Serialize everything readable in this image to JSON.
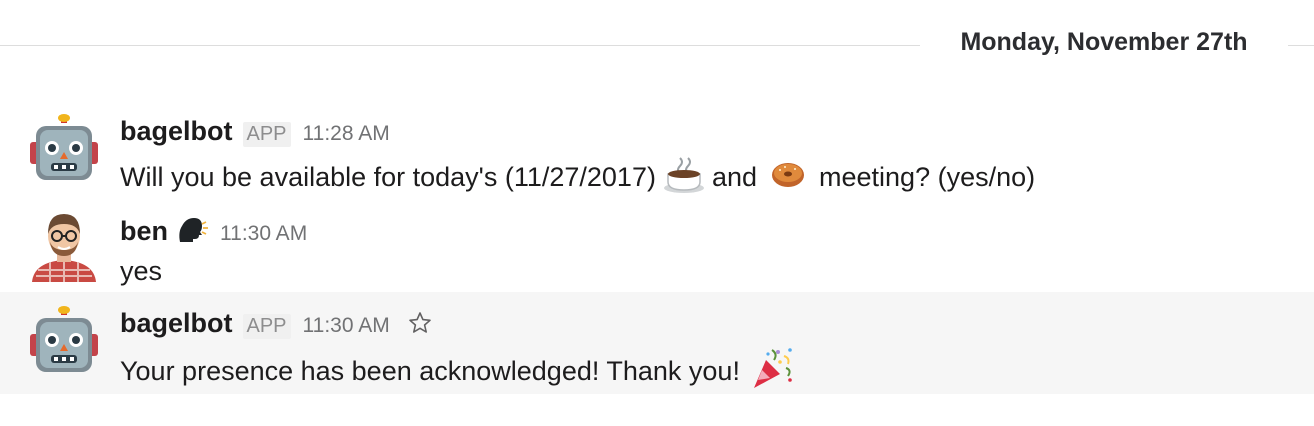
{
  "divider": {
    "date": "Monday, November 27th"
  },
  "messages": [
    {
      "sender": "bagelbot",
      "badge": "APP",
      "time": "11:28 AM",
      "avatar": "robot-avatar",
      "text_before": "Will you be available for today's (11/27/2017)",
      "emoji_1": "coffee-icon",
      "text_mid": "and",
      "emoji_2": "bagel-icon",
      "text_after": "meeting? (yes/no)"
    },
    {
      "sender": "ben",
      "status_emoji": "speaking-head-icon",
      "time": "11:30 AM",
      "avatar": "ben-avatar",
      "text": "yes"
    },
    {
      "sender": "bagelbot",
      "badge": "APP",
      "time": "11:30 AM",
      "avatar": "robot-avatar",
      "text": "Your presence has been acknowledged! Thank you!",
      "emoji": "party-popper-icon",
      "action_icon": "star-icon"
    }
  ],
  "colors": {
    "highlight_background": "#f6f6f6",
    "timestamp": "#717274",
    "divider": "#dddddd"
  }
}
